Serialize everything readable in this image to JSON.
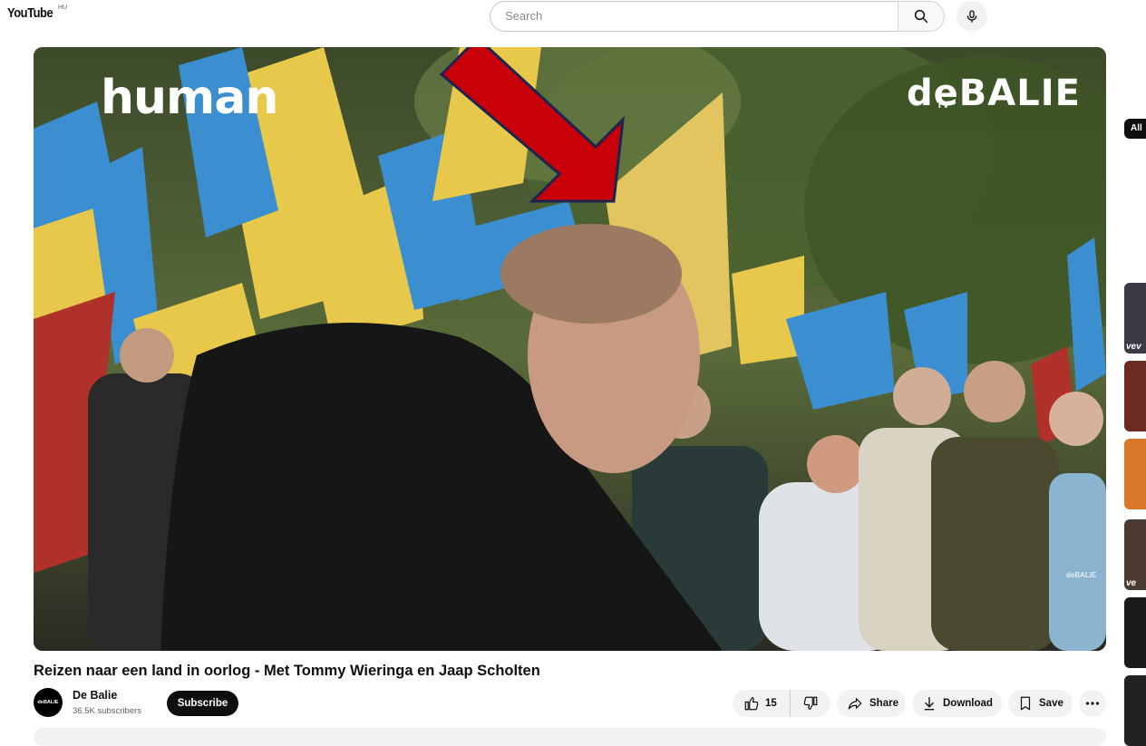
{
  "header": {
    "logo_text": "YouTube",
    "country_code": "HU",
    "search_placeholder": "Search",
    "search_icon": "search-icon",
    "mic_icon": "mic-icon"
  },
  "player": {
    "brand_left": "human",
    "brand_right": "deBALIE",
    "brand_right_tv": "TV",
    "watermark": "deBALIE"
  },
  "video": {
    "title": "Reizen naar een land in oorlog - Met Tommy Wieringa en Jaap Scholten",
    "channel": {
      "avatar_text": "deBALIE",
      "name": "De Balie",
      "subscribers": "36.5K subscribers"
    },
    "subscribe_label": "Subscribe",
    "actions": {
      "like_count": "15",
      "share_label": "Share",
      "download_label": "Download",
      "save_label": "Save",
      "more_icon": "more-icon"
    }
  },
  "sidebar": {
    "chip_all": "All",
    "thumbnails": [
      {
        "label": "vev",
        "color": "#3b3b46"
      },
      {
        "label": "",
        "color": "#6b2a22"
      },
      {
        "label": "",
        "color": "#d9782a"
      },
      {
        "label": "ve",
        "color": "#4a3a30"
      },
      {
        "label": "",
        "color": "#1a1a1a"
      },
      {
        "label": "",
        "color": "#222222"
      }
    ]
  },
  "colors": {
    "annotation_arrow": "#c8000a",
    "flag_blue": "#3b8fd1",
    "flag_yellow": "#e8c84a",
    "subscribe_bg": "#0f0f0f"
  }
}
